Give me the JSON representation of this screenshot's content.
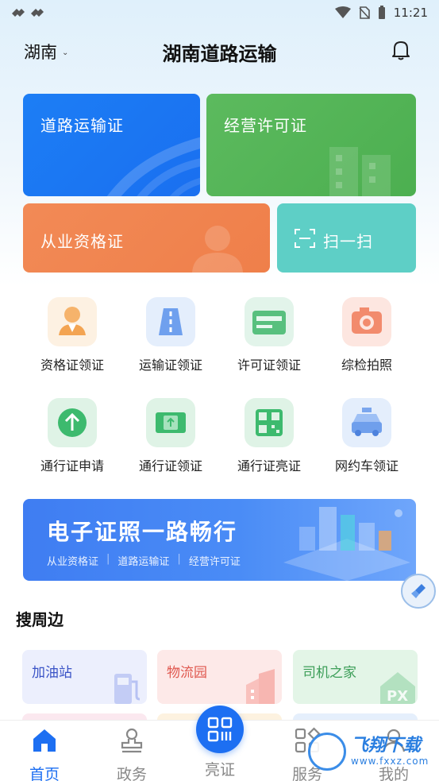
{
  "status_bar": {
    "time": "11:21"
  },
  "header": {
    "city": "湖南",
    "title": "湖南道路运输"
  },
  "cards": {
    "road": "道路运输证",
    "license": "经营许可证",
    "qualification": "从业资格证",
    "scan": "扫一扫"
  },
  "grid": [
    {
      "label": "资格证领证",
      "icon": "person-icon"
    },
    {
      "label": "运输证领证",
      "icon": "road-icon"
    },
    {
      "label": "许可证领证",
      "icon": "card-icon"
    },
    {
      "label": "综检拍照",
      "icon": "camera-icon"
    },
    {
      "label": "通行证申请",
      "icon": "arrow-up-icon"
    },
    {
      "label": "通行证领证",
      "icon": "pass-icon"
    },
    {
      "label": "通行证亮证",
      "icon": "qr-icon"
    },
    {
      "label": "网约车领证",
      "icon": "car-icon"
    }
  ],
  "banner": {
    "title": "电子证照一路畅行",
    "items": [
      "从业资格证",
      "道路运输证",
      "经营许可证"
    ]
  },
  "nearby": {
    "title": "搜周边",
    "items": [
      "加油站",
      "物流园",
      "司机之家"
    ]
  },
  "tabbar": {
    "home": "首页",
    "gov": "政务",
    "show": "亮证",
    "service": "服务",
    "mine": "我的"
  },
  "watermark": {
    "text": "飞翔下载",
    "url": "www.fxxz.com"
  },
  "colors": {
    "primary": "#1d6ff2",
    "road_card": "#1c7ef5",
    "license_card": "#4caf50",
    "qual_card": "#ef7f4a",
    "scan_card": "#5ecfc6"
  }
}
